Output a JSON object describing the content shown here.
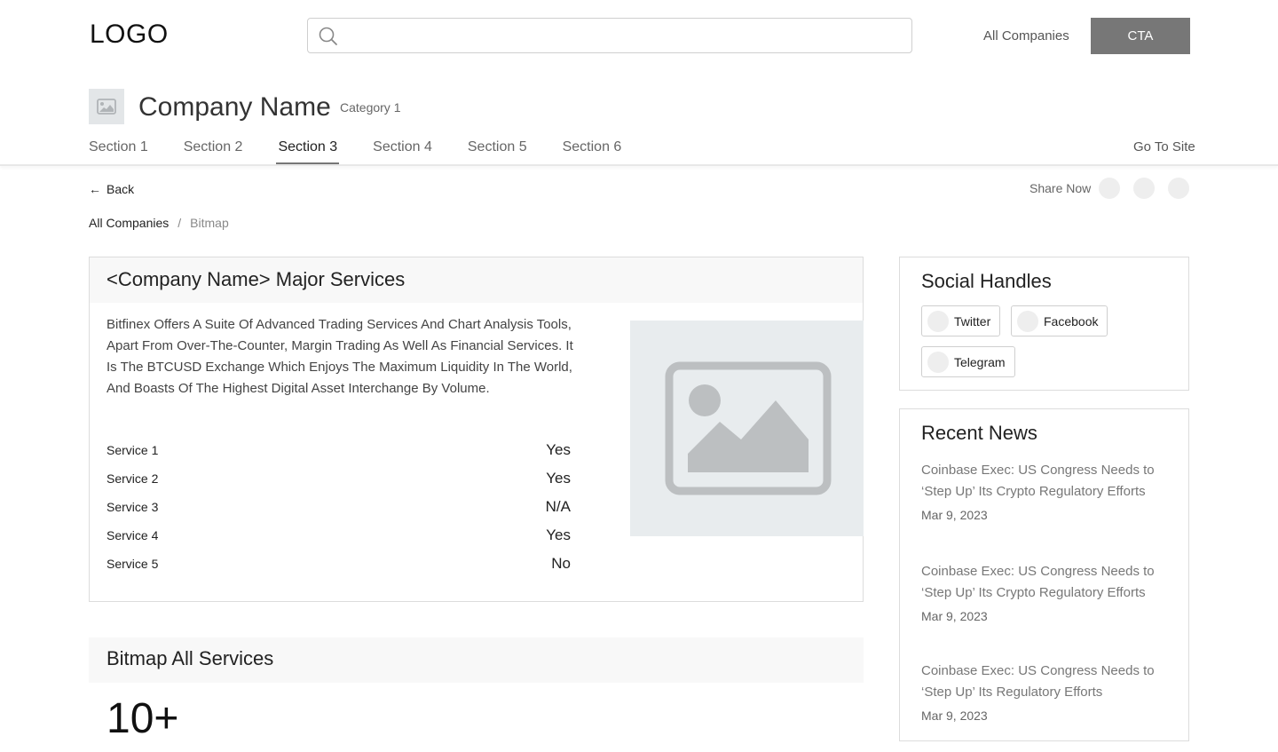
{
  "header": {
    "logo": "LOGO",
    "search": {
      "value": "",
      "placeholder": ""
    },
    "nav_link": "All Companies",
    "cta": "CTA"
  },
  "company": {
    "name": "Company Name",
    "category": "Category 1"
  },
  "tabs": [
    {
      "label": "Section 1",
      "active": false
    },
    {
      "label": "Section 2",
      "active": false
    },
    {
      "label": "Section 3",
      "active": true
    },
    {
      "label": "Section 4",
      "active": false
    },
    {
      "label": "Section 5",
      "active": false
    },
    {
      "label": "Section 6",
      "active": false
    }
  ],
  "go_to_site": "Go To Site",
  "back_label": "Back",
  "share_label": "Share Now",
  "breadcrumb": {
    "link": "All Companies",
    "separator": "/",
    "current": "Bitmap"
  },
  "services_card": {
    "title": "<Company Name> Major Services",
    "description": "Bitfinex Offers A Suite Of Advanced Trading Services And Chart Analysis Tools, Apart From Over-The-Counter, Margin Trading As Well As Financial Services. It Is The BTCUSD Exchange Which Enjoys The Maximum Liquidity In The World, And Boasts Of The Highest Digital Asset Interchange By Volume.",
    "services": [
      {
        "name": "Service 1",
        "value": "Yes"
      },
      {
        "name": "Service 2",
        "value": "Yes"
      },
      {
        "name": "Service 3",
        "value": "N/A"
      },
      {
        "name": "Service 4",
        "value": "Yes"
      },
      {
        "name": "Service 5",
        "value": "No"
      }
    ]
  },
  "all_services": {
    "title": "Bitmap All Services",
    "count": "10+"
  },
  "social": {
    "title": "Social Handles",
    "handles": [
      "Twitter",
      "Facebook",
      "Telegram"
    ]
  },
  "news": {
    "title": "Recent News",
    "items": [
      {
        "title": "Coinbase Exec: US Congress Needs to ‘Step Up’ Its Crypto Regulatory Efforts",
        "date": "Mar 9, 2023"
      },
      {
        "title": "Coinbase Exec: US Congress Needs to ‘Step Up’ Its Crypto Regulatory Efforts",
        "date": "Mar 9, 2023"
      },
      {
        "title": "Coinbase Exec: US Congress Needs to ‘Step Up’ Its Regulatory Efforts",
        "date": "Mar 9, 2023"
      }
    ]
  },
  "colors": {
    "cta_bg": "#777777",
    "placeholder_bg": "#e8ecee",
    "placeholder_icon": "#bcbfc1",
    "card_head_bg": "#f8f8f8"
  }
}
